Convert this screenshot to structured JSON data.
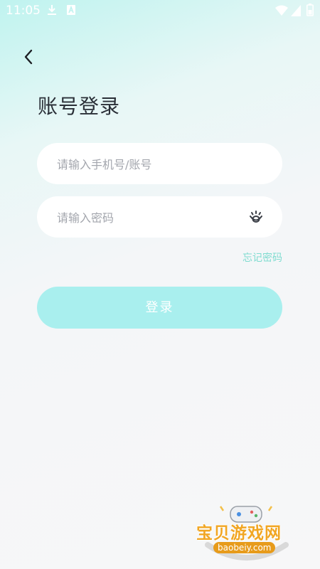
{
  "status_bar": {
    "time": "11:05",
    "colors": {
      "fg": "#ffffff"
    }
  },
  "header": {
    "title": "账号登录"
  },
  "form": {
    "account": {
      "placeholder": "请输入手机号/账号",
      "value": ""
    },
    "password": {
      "placeholder": "请输入密码",
      "value": ""
    },
    "forgot_label": "忘记密码",
    "login_label": "登录"
  },
  "watermark": {
    "brand": "宝贝游戏网",
    "url": "baobeiy.com"
  },
  "colors": {
    "accent": "#7fdcd0",
    "button": "#a9efee",
    "title": "#2a2f37",
    "placeholder": "#a3a6ad"
  },
  "icons": [
    "download-icon",
    "a-icon",
    "wifi-icon",
    "signal-icon",
    "battery-icon",
    "back-arrow-icon",
    "eye-icon"
  ]
}
